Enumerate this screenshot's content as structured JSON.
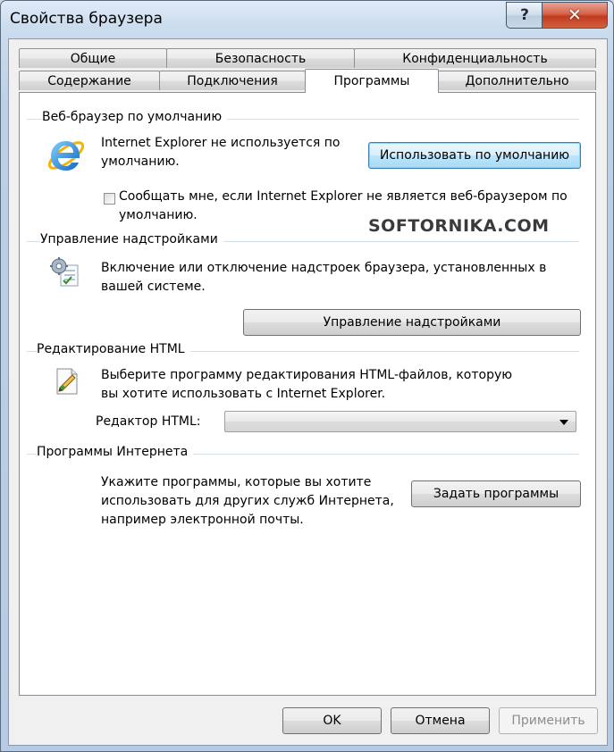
{
  "window": {
    "title": "Свойства браузера",
    "help_label": "?",
    "close_label": "✕"
  },
  "tabs": {
    "row1": [
      "Общие",
      "Безопасность",
      "Конфиденциальность"
    ],
    "row2": [
      "Содержание",
      "Подключения",
      "Программы",
      "Дополнительно"
    ],
    "active": "Программы"
  },
  "default_browser": {
    "header": "Веб-браузер по умолчанию",
    "line1": "Internet Explorer не используется по",
    "line2": "умолчанию.",
    "button": "Использовать по умолчанию",
    "checkbox_line1": "Сообщать мне, если Internet Explorer не является веб-браузером по",
    "checkbox_line2": "умолчанию.",
    "checkbox_checked": false,
    "icon": "ie-logo-icon"
  },
  "watermark": "SOFTORNIKA.COM",
  "addons": {
    "header": "Управление надстройками",
    "line1": "Включение или отключение надстроек браузера, установленных в",
    "line2": "вашей системе.",
    "button": "Управление надстройками",
    "icon": "gear-list-icon"
  },
  "html_editing": {
    "header": "Редактирование HTML",
    "line1": "Выберите программу редактирования HTML-файлов, которую",
    "line2": "вы хотите использовать с Internet Explorer.",
    "editor_label": "Редактор HTML:",
    "editor_value": "",
    "icon": "pencil-page-icon"
  },
  "internet_programs": {
    "header": "Программы Интернета",
    "line1": "Укажите программы, которые вы хотите",
    "line2": "использовать для других служб Интернета,",
    "line3": "например электронной почты.",
    "button": "Задать программы"
  },
  "footer": {
    "ok": "OK",
    "cancel": "Отмена",
    "apply": "Применить"
  },
  "colors": {
    "accent": "#3c7fb1",
    "close_red": "#c03a1e",
    "group_line": "#d5dfe5"
  }
}
